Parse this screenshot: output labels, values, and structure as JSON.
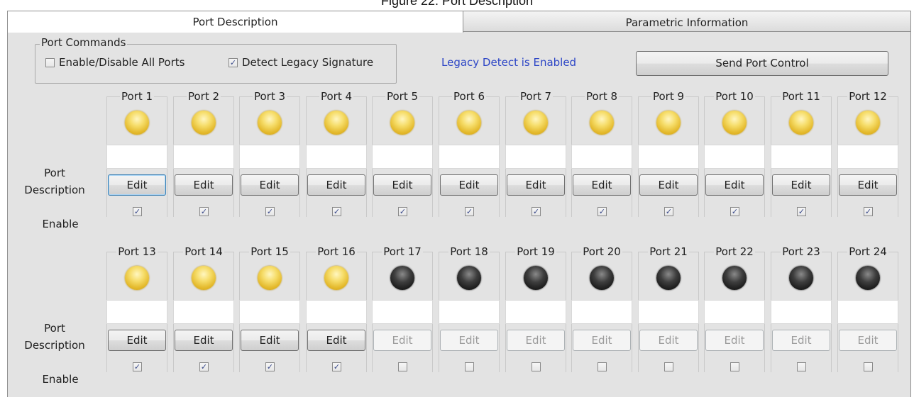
{
  "figure_caption": "Figure 22. Port Description",
  "tabs": [
    {
      "label": "Port Description",
      "active": true
    },
    {
      "label": "Parametric Information",
      "active": false
    }
  ],
  "port_commands": {
    "title": "Port Commands",
    "enable_disable_all": {
      "label": "Enable/Disable All Ports",
      "checked": false
    },
    "detect_legacy": {
      "label": "Detect Legacy Signature",
      "checked": true
    },
    "legacy_status": "Legacy Detect is Enabled",
    "send_button": "Send Port Control"
  },
  "row_labels": {
    "port_description": "Port\nDescription",
    "enable": "Enable"
  },
  "edit_label": "Edit",
  "colors": {
    "led_on": "#e3b82a",
    "led_off": "#1c1c1c",
    "status_text": "#2d46c6"
  },
  "ports": [
    {
      "name": "Port 1",
      "led": "on",
      "enabled": true,
      "edit_enabled": true,
      "focused": true
    },
    {
      "name": "Port 2",
      "led": "on",
      "enabled": true,
      "edit_enabled": true
    },
    {
      "name": "Port 3",
      "led": "on",
      "enabled": true,
      "edit_enabled": true
    },
    {
      "name": "Port 4",
      "led": "on",
      "enabled": true,
      "edit_enabled": true
    },
    {
      "name": "Port 5",
      "led": "on",
      "enabled": true,
      "edit_enabled": true
    },
    {
      "name": "Port 6",
      "led": "on",
      "enabled": true,
      "edit_enabled": true
    },
    {
      "name": "Port 7",
      "led": "on",
      "enabled": true,
      "edit_enabled": true
    },
    {
      "name": "Port 8",
      "led": "on",
      "enabled": true,
      "edit_enabled": true
    },
    {
      "name": "Port 9",
      "led": "on",
      "enabled": true,
      "edit_enabled": true
    },
    {
      "name": "Port 10",
      "led": "on",
      "enabled": true,
      "edit_enabled": true
    },
    {
      "name": "Port 11",
      "led": "on",
      "enabled": true,
      "edit_enabled": true
    },
    {
      "name": "Port 12",
      "led": "on",
      "enabled": true,
      "edit_enabled": true
    },
    {
      "name": "Port 13",
      "led": "on",
      "enabled": true,
      "edit_enabled": true
    },
    {
      "name": "Port 14",
      "led": "on",
      "enabled": true,
      "edit_enabled": true
    },
    {
      "name": "Port 15",
      "led": "on",
      "enabled": true,
      "edit_enabled": true
    },
    {
      "name": "Port 16",
      "led": "on",
      "enabled": true,
      "edit_enabled": true
    },
    {
      "name": "Port 17",
      "led": "off",
      "enabled": false,
      "edit_enabled": false
    },
    {
      "name": "Port 18",
      "led": "off",
      "enabled": false,
      "edit_enabled": false
    },
    {
      "name": "Port 19",
      "led": "off",
      "enabled": false,
      "edit_enabled": false
    },
    {
      "name": "Port 20",
      "led": "off",
      "enabled": false,
      "edit_enabled": false
    },
    {
      "name": "Port 21",
      "led": "off",
      "enabled": false,
      "edit_enabled": false
    },
    {
      "name": "Port 22",
      "led": "off",
      "enabled": false,
      "edit_enabled": false
    },
    {
      "name": "Port 23",
      "led": "off",
      "enabled": false,
      "edit_enabled": false
    },
    {
      "name": "Port 24",
      "led": "off",
      "enabled": false,
      "edit_enabled": false
    }
  ]
}
